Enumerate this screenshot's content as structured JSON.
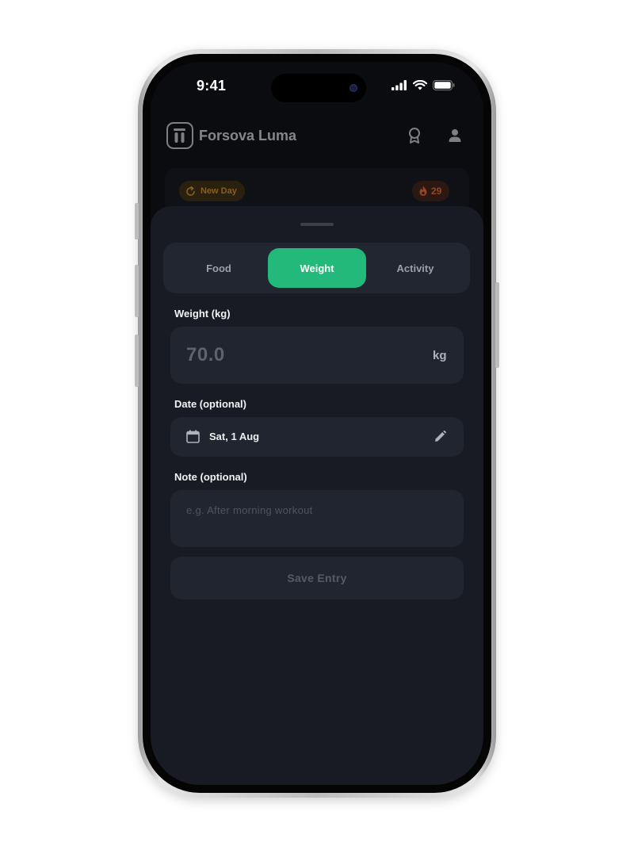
{
  "status_bar": {
    "time": "9:41"
  },
  "header": {
    "app_name": "Forsova Luma"
  },
  "banner": {
    "new_day_label": "New Day",
    "streak_count": "29"
  },
  "tabs": [
    {
      "label": "Food",
      "active": false
    },
    {
      "label": "Weight",
      "active": true
    },
    {
      "label": "Activity",
      "active": false
    }
  ],
  "form": {
    "weight_label": "Weight (kg)",
    "weight_placeholder": "70.0",
    "weight_unit": "kg",
    "date_label": "Date (optional)",
    "date_value": "Sat, 1 Aug",
    "note_label": "Note (optional)",
    "note_placeholder": "e.g. After morning workout",
    "save_label": "Save Entry"
  },
  "colors": {
    "accent": "#23b97a",
    "sheet_bg": "#181b23",
    "field_bg": "#212530",
    "new_day": "#d89322",
    "streak": "#ef6a2a"
  }
}
